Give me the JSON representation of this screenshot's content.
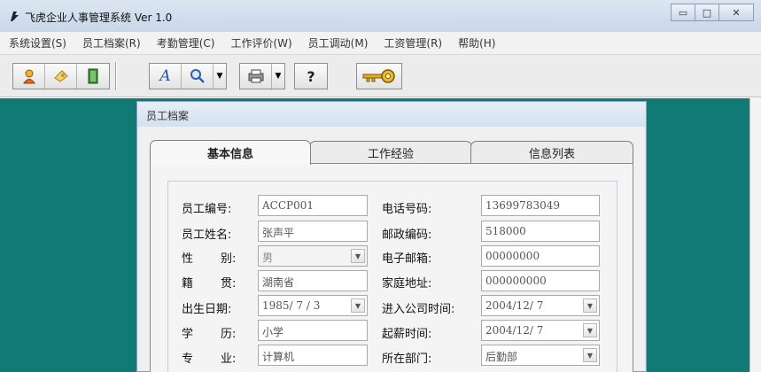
{
  "window": {
    "title": "飞虎企业人事管理系统 Ver 1.0"
  },
  "menu": [
    "系统设置(S)",
    "员工档案(R)",
    "考勤管理(C)",
    "工作评价(W)",
    "员工调动(M)",
    "工资管理(R)",
    "帮助(H)"
  ],
  "toolbar": {
    "icons": [
      "person-icon",
      "note-icon",
      "exit-door-icon",
      "text-icon",
      "search-icon",
      "print-icon",
      "help-icon",
      "key-icon"
    ]
  },
  "child_window": {
    "title": "员工档案"
  },
  "tabs": [
    "基本信息",
    "工作经验",
    "信息列表"
  ],
  "form": {
    "employee_no": {
      "label": "员工编号:",
      "value": "ACCP001"
    },
    "employee_name": {
      "label": "员工姓名:",
      "value": "张声平"
    },
    "gender": {
      "label_a": "性",
      "label_b": "别:",
      "value": "男"
    },
    "native_place": {
      "label_a": "籍",
      "label_b": "贯:",
      "value": "湖南省"
    },
    "birth_date": {
      "label": "出生日期:",
      "value": "1985/ 7 / 3"
    },
    "education": {
      "label_a": "学",
      "label_b": "历:",
      "value": "小学"
    },
    "major": {
      "label_a": "专",
      "label_b": "业:",
      "value": "计算机"
    },
    "phone": {
      "label": "电话号码:",
      "value": "13699783049"
    },
    "postcode": {
      "label": "邮政编码:",
      "value": "518000"
    },
    "email": {
      "label": "电子邮箱:",
      "value": "00000000"
    },
    "address": {
      "label": "家庭地址:",
      "value": "000000000"
    },
    "join_date": {
      "label": "进入公司时间:",
      "value": "2004/12/ 7"
    },
    "salary_start": {
      "label": "起薪时间:",
      "value": "2004/12/ 7"
    },
    "department": {
      "label": "所在部门:",
      "value": "后勤部"
    }
  },
  "colors": {
    "workspace": "#117a74",
    "menu_text": "#333333"
  }
}
